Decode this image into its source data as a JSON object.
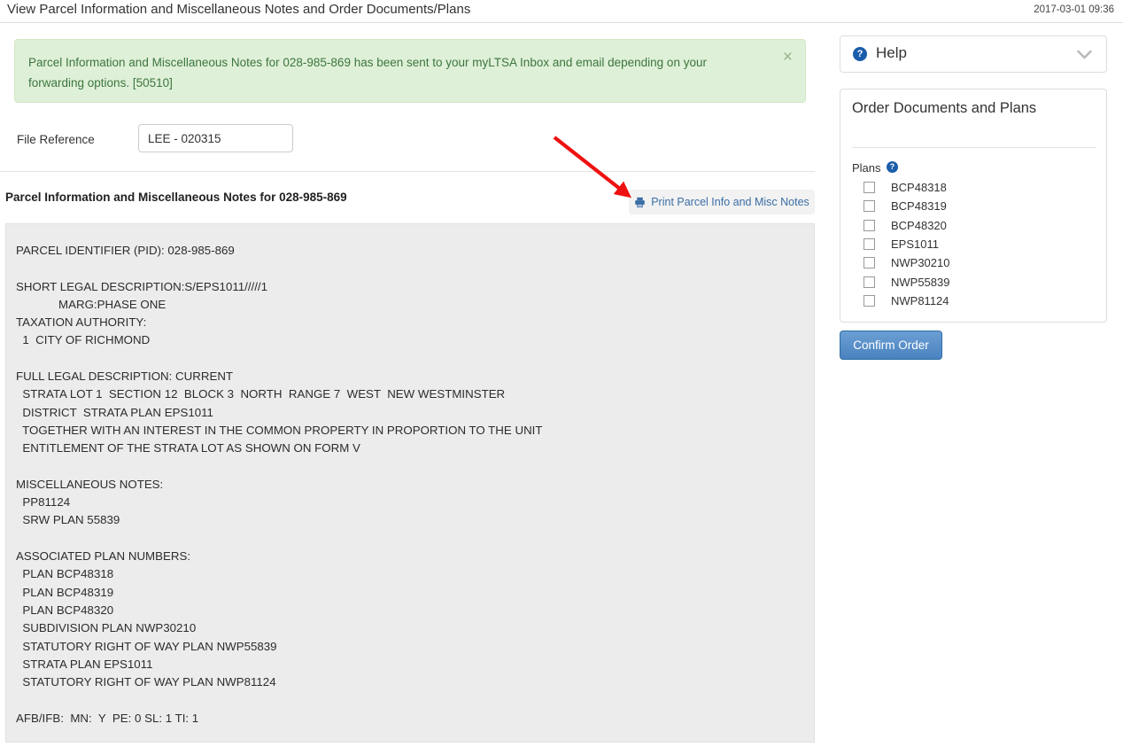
{
  "header": {
    "title": "View Parcel Information and Miscellaneous Notes and Order Documents/Plans",
    "datetime": "2017-03-01 09:36"
  },
  "alert": {
    "message": "Parcel Information and Miscellaneous Notes for 028-985-869 has been sent to your myLTSA Inbox and email depending on your forwarding options. [50510]",
    "close_label": "×"
  },
  "file_reference": {
    "label": "File Reference",
    "value": "LEE - 020315",
    "placeholder": "File Reference"
  },
  "section": {
    "heading": "Parcel Information and Miscellaneous Notes for 028-985-869",
    "print_button_label": "Print Parcel Info and Misc Notes",
    "print_icon": "printer-icon"
  },
  "notes": {
    "body": "PARCEL IDENTIFIER (PID): 028-985-869\n\nSHORT LEGAL DESCRIPTION:S/EPS1011/////1\n             MARG:PHASE ONE\nTAXATION AUTHORITY:\n  1  CITY OF RICHMOND\n\nFULL LEGAL DESCRIPTION: CURRENT\n  STRATA LOT 1  SECTION 12  BLOCK 3  NORTH  RANGE 7  WEST  NEW WESTMINSTER\n  DISTRICT  STRATA PLAN EPS1011\n  TOGETHER WITH AN INTEREST IN THE COMMON PROPERTY IN PROPORTION TO THE UNIT\n  ENTITLEMENT OF THE STRATA LOT AS SHOWN ON FORM V\n\nMISCELLANEOUS NOTES:\n  PP81124\n  SRW PLAN 55839\n\nASSOCIATED PLAN NUMBERS:\n  PLAN BCP48318\n  PLAN BCP48319\n  PLAN BCP48320\n  SUBDIVISION PLAN NWP30210\n  STATUTORY RIGHT OF WAY PLAN NWP55839\n  STRATA PLAN EPS1011\n  STATUTORY RIGHT OF WAY PLAN NWP81124\n\nAFB/IFB:  MN:  Y  PE: 0 SL: 1 TI: 1"
  },
  "sidebar": {
    "help": {
      "label": "Help",
      "help_icon": "question-circle-icon",
      "chevron_icon": "chevron-down-icon"
    },
    "order": {
      "title": "Order Documents and Plans",
      "plans_label": "Plans",
      "plans_help_icon": "question-circle-icon",
      "plans": [
        {
          "label": "BCP48318",
          "checked": false
        },
        {
          "label": "BCP48319",
          "checked": false
        },
        {
          "label": "BCP48320",
          "checked": false
        },
        {
          "label": "EPS1011",
          "checked": false
        },
        {
          "label": "NWP30210",
          "checked": false
        },
        {
          "label": "NWP55839",
          "checked": false
        },
        {
          "label": "NWP81124",
          "checked": false
        }
      ]
    },
    "confirm_label": "Confirm Order"
  },
  "annotation": {
    "arrow_color": "#ee1111",
    "arrow_name": "red-pointer-arrow"
  },
  "colors": {
    "alert_bg": "#dff0d8",
    "alert_text": "#3c763d",
    "link_blue": "#3a6ea5",
    "panel_bg": "#ececec",
    "primary_button": "#4a82c0"
  }
}
